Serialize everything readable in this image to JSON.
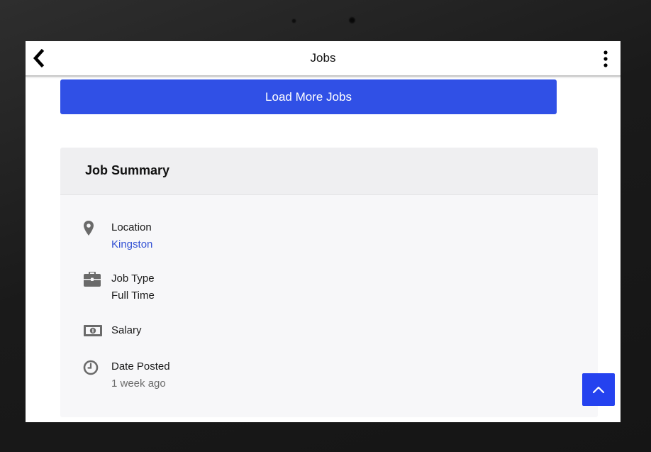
{
  "appbar": {
    "title": "Jobs",
    "back_icon": "chevron-left-icon",
    "menu_icon": "more-vertical-icon"
  },
  "actions": {
    "load_more_label": "Load More Jobs"
  },
  "summary": {
    "title": "Job Summary",
    "items": [
      {
        "icon": "location-pin-icon",
        "label": "Location",
        "value": "Kingston"
      },
      {
        "icon": "briefcase-icon",
        "label": "Job Type",
        "value": "Full Time"
      },
      {
        "icon": "money-icon",
        "label": "Salary",
        "value": ""
      },
      {
        "icon": "clock-icon",
        "label": "Date Posted",
        "value": "1 week ago"
      }
    ]
  },
  "scroll_top_icon": "chevron-up-icon",
  "colors": {
    "accent": "#3050e6",
    "link": "#3452d4",
    "scroll_button": "#2542ef",
    "card_background": "#f7f7f9",
    "card_header": "#efeff1"
  }
}
